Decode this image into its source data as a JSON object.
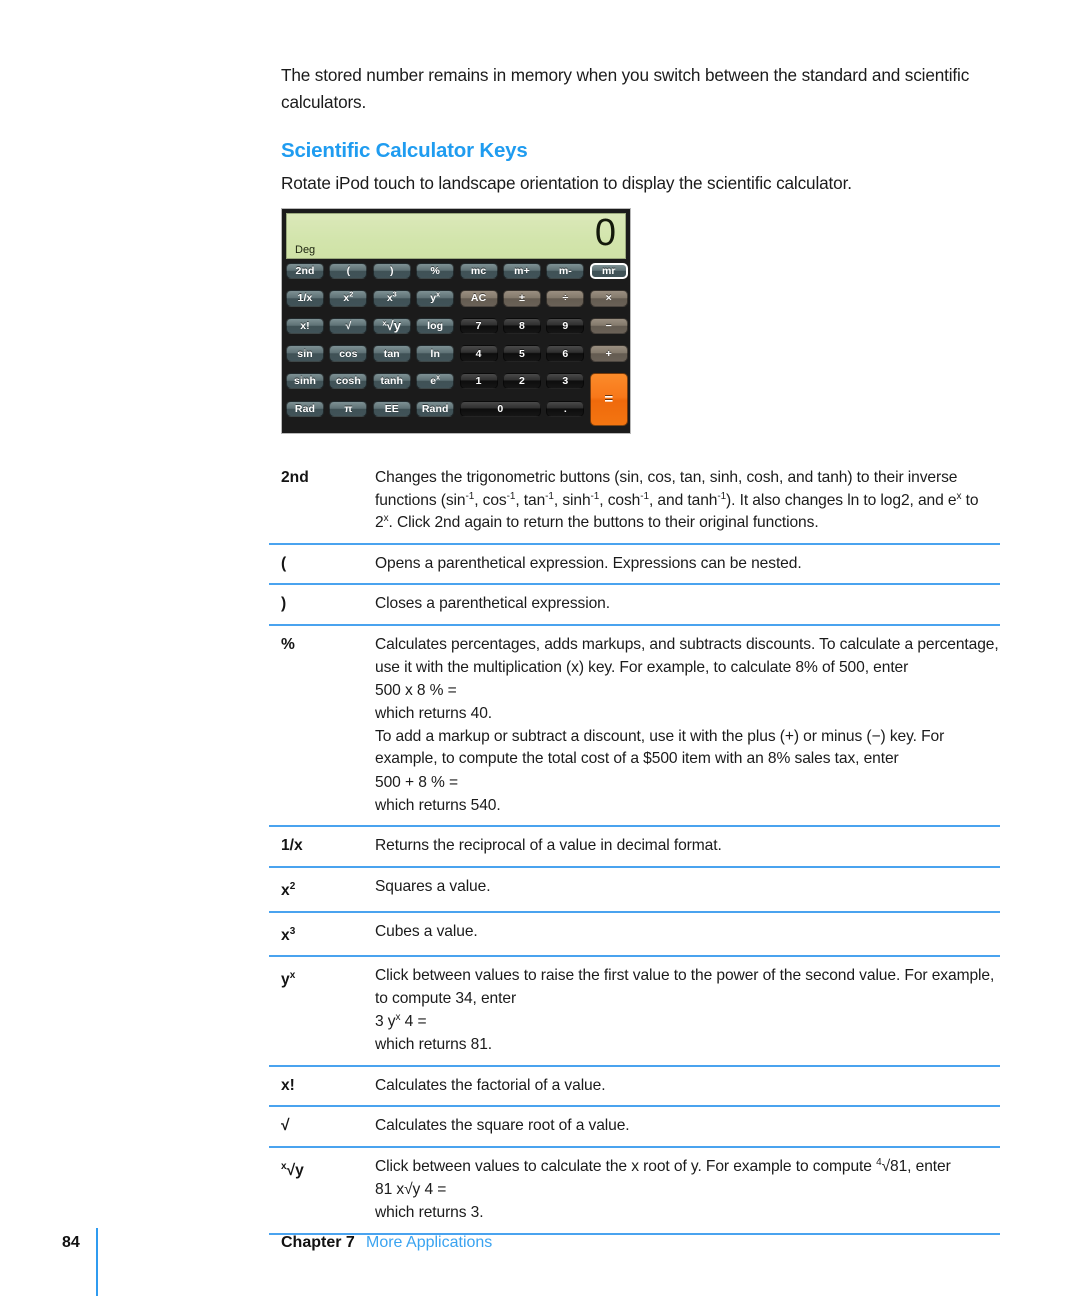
{
  "document": {
    "intro_paragraph": "The stored number remains in memory when you switch between the standard and scientific calculators.",
    "section_heading": "Scientific Calculator Keys",
    "sub_paragraph": "Rotate iPod touch to landscape orientation to display the scientific calculator."
  },
  "colors": {
    "heading_blue": "#1f9cf0",
    "rule_blue": "#4aa3ef",
    "link_blue": "#3aa3f0",
    "lcd_green": "#d3e5ad",
    "equals_orange": "#f8781a"
  },
  "calculator": {
    "display": {
      "mode_label": "Deg",
      "value": "0"
    },
    "keys": [
      {
        "label": "2nd",
        "kind": "fn",
        "row": 0,
        "col": 0
      },
      {
        "label": "(",
        "kind": "fn",
        "row": 0,
        "col": 1
      },
      {
        "label": ")",
        "kind": "fn",
        "row": 0,
        "col": 2
      },
      {
        "label": "%",
        "kind": "fn",
        "row": 0,
        "col": 3
      },
      {
        "label": "mc",
        "kind": "mem",
        "row": 0,
        "col": 4
      },
      {
        "label": "m+",
        "kind": "mem",
        "row": 0,
        "col": 5
      },
      {
        "label": "m-",
        "kind": "mem",
        "row": 0,
        "col": 6
      },
      {
        "label": "mr",
        "kind": "mem",
        "row": 0,
        "col": 7,
        "active": true
      },
      {
        "label": "1/x",
        "kind": "fn",
        "row": 1,
        "col": 0
      },
      {
        "label": "x2",
        "kind": "fn",
        "row": 1,
        "col": 1,
        "sup": "2",
        "base": "x"
      },
      {
        "label": "x3",
        "kind": "fn",
        "row": 1,
        "col": 2,
        "sup": "3",
        "base": "x"
      },
      {
        "label": "yx",
        "kind": "fn",
        "row": 1,
        "col": 3,
        "sup": "x",
        "base": "y"
      },
      {
        "label": "AC",
        "kind": "op",
        "row": 1,
        "col": 4
      },
      {
        "label": "±",
        "kind": "op",
        "row": 1,
        "col": 5
      },
      {
        "label": "÷",
        "kind": "op",
        "row": 1,
        "col": 6
      },
      {
        "label": "×",
        "kind": "op",
        "row": 1,
        "col": 7
      },
      {
        "label": "x!",
        "kind": "fn",
        "row": 2,
        "col": 0
      },
      {
        "label": "√",
        "kind": "fn",
        "row": 2,
        "col": 1
      },
      {
        "label": "x√y",
        "kind": "fn",
        "row": 2,
        "col": 2,
        "pre": "x",
        "base": "√y"
      },
      {
        "label": "log",
        "kind": "fn",
        "row": 2,
        "col": 3
      },
      {
        "label": "7",
        "kind": "num",
        "row": 2,
        "col": 4
      },
      {
        "label": "8",
        "kind": "num",
        "row": 2,
        "col": 5
      },
      {
        "label": "9",
        "kind": "num",
        "row": 2,
        "col": 6
      },
      {
        "label": "−",
        "kind": "op",
        "row": 2,
        "col": 7
      },
      {
        "label": "sin",
        "kind": "fn",
        "row": 3,
        "col": 0
      },
      {
        "label": "cos",
        "kind": "fn",
        "row": 3,
        "col": 1
      },
      {
        "label": "tan",
        "kind": "fn",
        "row": 3,
        "col": 2
      },
      {
        "label": "ln",
        "kind": "fn",
        "row": 3,
        "col": 3
      },
      {
        "label": "4",
        "kind": "num",
        "row": 3,
        "col": 4
      },
      {
        "label": "5",
        "kind": "num",
        "row": 3,
        "col": 5
      },
      {
        "label": "6",
        "kind": "num",
        "row": 3,
        "col": 6
      },
      {
        "label": "+",
        "kind": "op",
        "row": 3,
        "col": 7
      },
      {
        "label": "sinh",
        "kind": "fn",
        "row": 4,
        "col": 0
      },
      {
        "label": "cosh",
        "kind": "fn",
        "row": 4,
        "col": 1
      },
      {
        "label": "tanh",
        "kind": "fn",
        "row": 4,
        "col": 2
      },
      {
        "label": "ex",
        "kind": "fn",
        "row": 4,
        "col": 3,
        "sup": "x",
        "base": "e"
      },
      {
        "label": "1",
        "kind": "num",
        "row": 4,
        "col": 4
      },
      {
        "label": "2",
        "kind": "num",
        "row": 4,
        "col": 5
      },
      {
        "label": "3",
        "kind": "num",
        "row": 4,
        "col": 6
      },
      {
        "label": "=",
        "kind": "eq",
        "row": 4,
        "col": 7,
        "rowspan": 2
      },
      {
        "label": "Rad",
        "kind": "fn",
        "row": 5,
        "col": 0
      },
      {
        "label": "π",
        "kind": "fn",
        "row": 5,
        "col": 1
      },
      {
        "label": "EE",
        "kind": "fn",
        "row": 5,
        "col": 2
      },
      {
        "label": "Rand",
        "kind": "fn",
        "row": 5,
        "col": 3
      },
      {
        "label": "0",
        "kind": "num",
        "row": 5,
        "col": 4,
        "colspan": 2
      },
      {
        "label": ".",
        "kind": "num",
        "row": 5,
        "col": 6
      }
    ]
  },
  "key_descriptions": [
    {
      "key": "2nd",
      "key_html": "2nd",
      "paragraphs": [
        "Changes the trigonometric buttons (sin, cos, tan, sinh, cosh, and tanh) to their inverse functions (sin<sup>-1</sup>, cos<sup>-1</sup>, tan<sup>-1</sup>, sinh<sup>-1</sup>, cosh<sup>-1</sup>, and tanh<sup>-1</sup>). It also changes ln to log2, and e<sup>x</sup> to 2<sup>x</sup>. Click 2nd again to return the buttons to their original functions."
      ]
    },
    {
      "key": "(",
      "key_html": "(",
      "paragraphs": [
        "Opens a parenthetical expression. Expressions can be nested."
      ]
    },
    {
      "key": ")",
      "key_html": ")",
      "paragraphs": [
        "Closes a parenthetical expression."
      ]
    },
    {
      "key": "%",
      "key_html": "%",
      "paragraphs": [
        "Calculates percentages, adds markups, and subtracts discounts. To calculate a percentage, use it with the multiplication (x) key. For example, to calculate 8% of 500, enter",
        "500 x 8 % =",
        "which returns 40.",
        "To add a markup or subtract a discount, use it with the plus (+) or minus (−) key. For example, to compute the total cost of a $500 item with an 8% sales tax, enter",
        "500 + 8 % =",
        "which returns 540."
      ]
    },
    {
      "key": "1/x",
      "key_html": "1/x",
      "paragraphs": [
        "Returns the reciprocal of a value in decimal format."
      ]
    },
    {
      "key": "x2",
      "key_html": "x<sup>2</sup>",
      "paragraphs": [
        "Squares a value."
      ]
    },
    {
      "key": "x3",
      "key_html": "x<sup>3</sup>",
      "paragraphs": [
        "Cubes a value."
      ]
    },
    {
      "key": "yx",
      "key_html": "y<sup>x</sup>",
      "paragraphs": [
        "Click between values to raise the first value to the power of the second value. For example, to compute 34, enter",
        "3 y<sup>x</sup> 4 =",
        "which returns 81."
      ]
    },
    {
      "key": "x!",
      "key_html": "x!",
      "paragraphs": [
        "Calculates the factorial of a value."
      ]
    },
    {
      "key": "sqrt",
      "key_html": "√",
      "paragraphs": [
        "Calculates the square root of a value."
      ]
    },
    {
      "key": "xrooty",
      "key_html": "<span class=\"pre\">x</span>√y",
      "paragraphs": [
        "Click between values to calculate the x root of y. For example to compute <sup>4</sup>√81, enter",
        "81 <span class=\"pre\">x</span>√y 4 =",
        "which returns 3."
      ]
    }
  ],
  "footer": {
    "page_number": "84",
    "chapter": "Chapter 7",
    "chapter_title": "More Applications"
  }
}
